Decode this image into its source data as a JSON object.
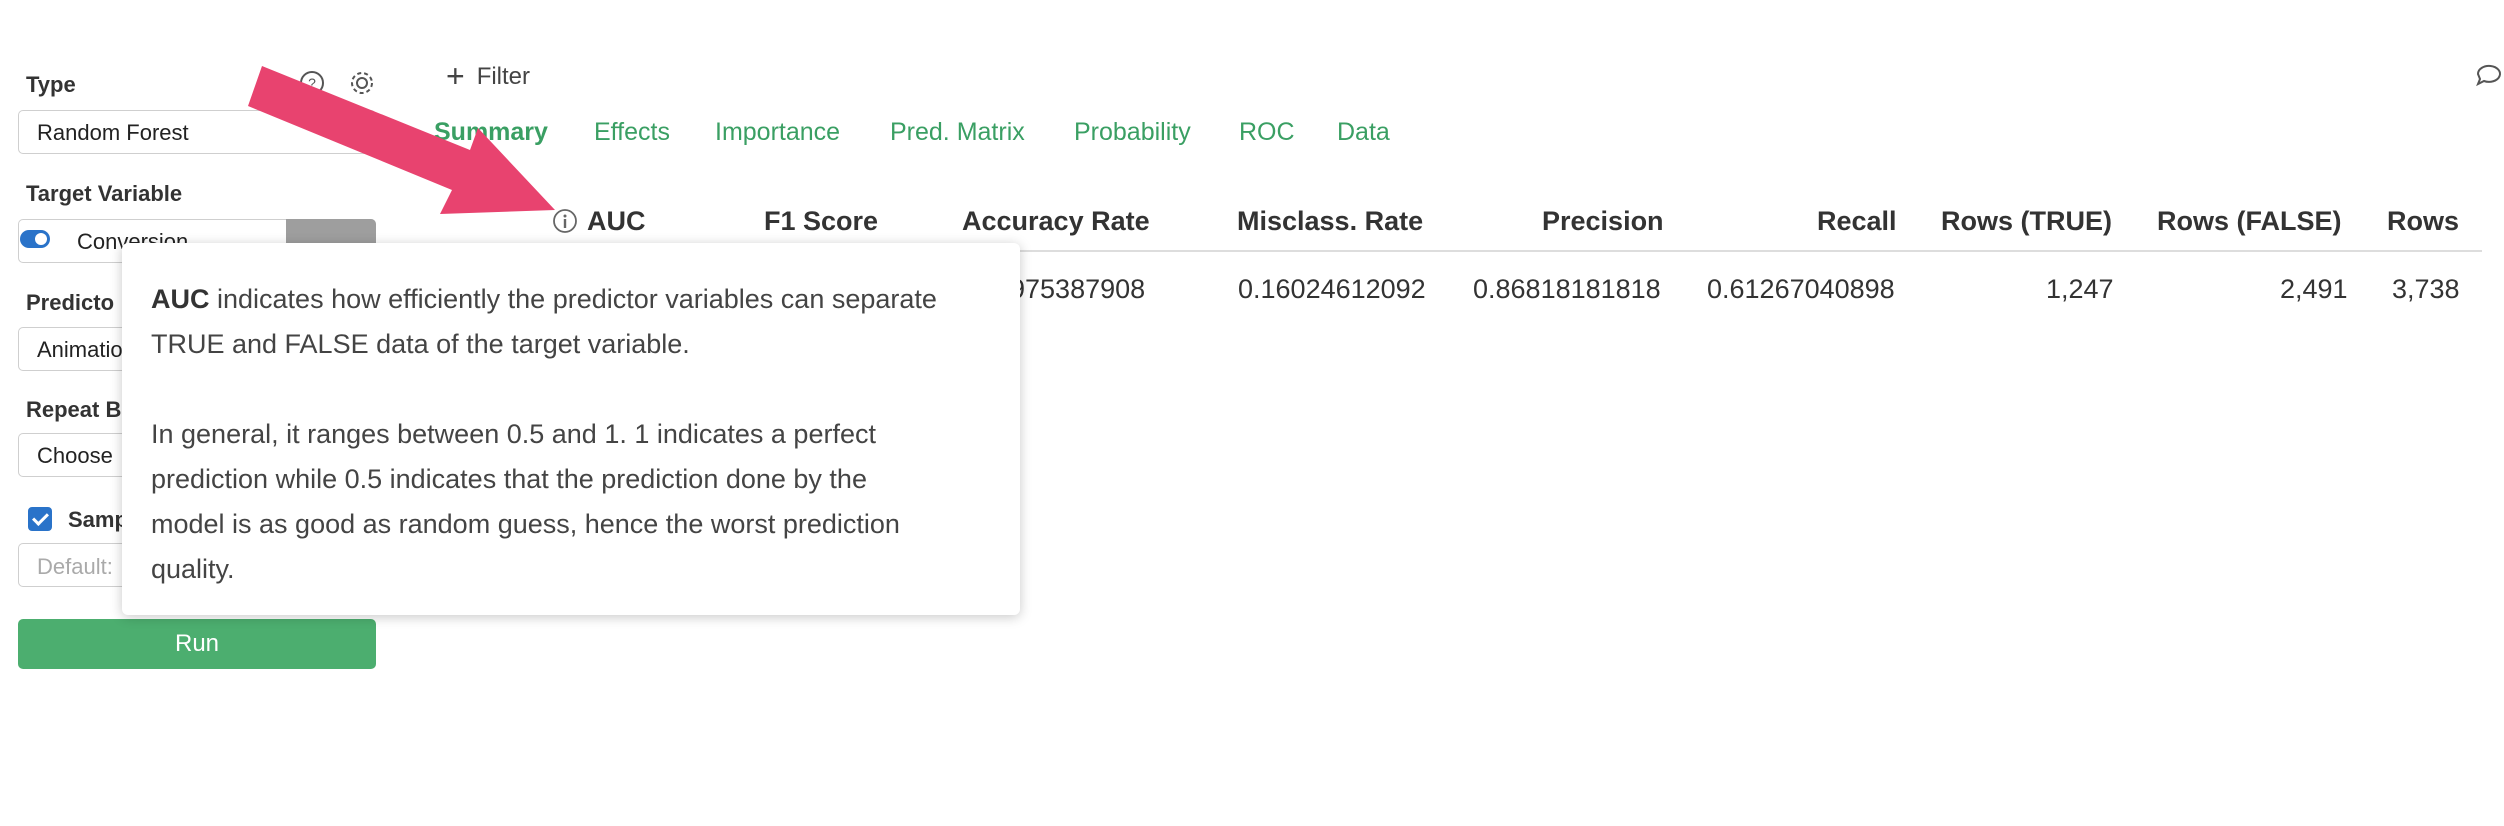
{
  "sidebar": {
    "type_label": "Type",
    "type_value": "Random Forest",
    "target_label": "Target Variable",
    "target_value": "Conversion",
    "predictor_label": "Predicto",
    "predictor_value": "Animatio",
    "repeat_label": "Repeat B",
    "repeat_value": "Choose",
    "sample_label": "Samp",
    "sample_placeholder": "Default:",
    "run_label": "Run"
  },
  "filter": {
    "label": "Filter"
  },
  "tabs": [
    {
      "label": "Summary"
    },
    {
      "label": "Effects"
    },
    {
      "label": "Importance"
    },
    {
      "label": "Pred. Matrix"
    },
    {
      "label": "Probability"
    },
    {
      "label": "ROC"
    },
    {
      "label": "Data"
    }
  ],
  "table": {
    "headers": [
      "AUC",
      "F1 Score",
      "Accuracy Rate",
      "Misclass. Rate",
      "Precision",
      "Recall",
      "Rows (TRUE)",
      "Rows (FALSE)",
      "Rows"
    ],
    "row": [
      "",
      "",
      "975387908",
      "0.16024612092",
      "0.86818181818",
      "0.61267040898",
      "1,247",
      "2,491",
      "3,738"
    ]
  },
  "tooltip": {
    "term": "AUC",
    "line1": " indicates how efficiently the predictor variables can separate",
    "line2": "TRUE and FALSE data of the target variable.",
    "para2_line1": "In general, it ranges between 0.5 and 1. 1 indicates a perfect",
    "para2_line2": "prediction while 0.5 indicates that the prediction done by the",
    "para2_line3": "model is as good as random guess, hence the worst prediction",
    "para2_line4": "quality."
  },
  "colors": {
    "accent_green": "#3a9f63",
    "run_button": "#4cae6f",
    "arrow": "#e8436f",
    "toggle_blue": "#2a73c9"
  },
  "icons": [
    "help-icon",
    "gear-icon",
    "plus-icon",
    "info-icon",
    "comment-icon",
    "chevron-down-icon"
  ]
}
